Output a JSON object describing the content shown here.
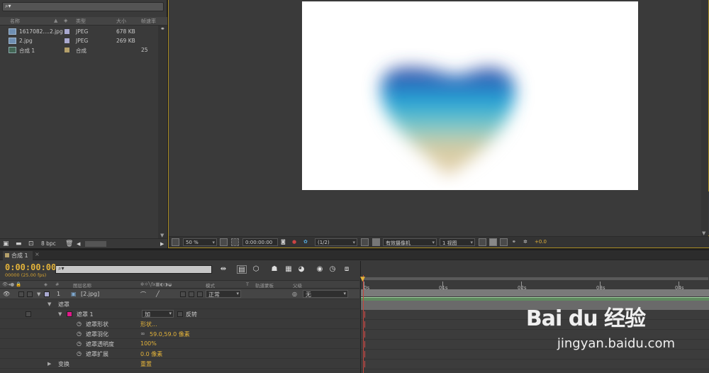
{
  "project": {
    "search_icon": "magnifier-icon",
    "headers": {
      "name": "名称",
      "type": "类型",
      "size": "大小",
      "fps": "帧速率"
    },
    "items": [
      {
        "name": "1617082....2.jpg",
        "type": "JPEG",
        "size": "678 KB",
        "fps": "",
        "label_color": "#a9a9d0",
        "icon": "image-file-icon"
      },
      {
        "name": "2.jpg",
        "type": "JPEG",
        "size": "269 KB",
        "fps": "",
        "label_color": "#a9a9d0",
        "icon": "image-file-icon"
      },
      {
        "name": "合成 1",
        "type": "合成",
        "size": "",
        "fps": "25",
        "label_color": "#b4a06a",
        "icon": "composition-icon"
      }
    ],
    "bpc": "8 bpc"
  },
  "viewer": {
    "zoom": "50 %",
    "timecode": "0:00:00:00",
    "resolution": "(1/2)",
    "camera": "有效摄像机",
    "views": "1 视图",
    "exposure": "+0.0"
  },
  "timeline": {
    "tab": "合成 1",
    "timecode": "0:00:00:00",
    "fps_line": "00000 (25.00 fps)",
    "time_labels": [
      "0s",
      "01s",
      "02s",
      "03s",
      "04s"
    ],
    "layer_headers": {
      "number": "#",
      "source_name": "图层名称",
      "mode": "模式",
      "t": "T",
      "trkmat": "轨道蒙板",
      "parent": "父级"
    },
    "layer": {
      "number": "1",
      "name": "[2.jpg]",
      "mode": "正常",
      "parent": "无"
    },
    "mask_group": "遮罩",
    "mask": {
      "name": "遮罩 1",
      "mode": "加",
      "invert": "反转",
      "color": "#e0198a"
    },
    "props": [
      {
        "name": "遮罩形状",
        "value": "形状..."
      },
      {
        "name": "遮罩羽化",
        "value": "59.0,59.0 像素"
      },
      {
        "name": "遮罩透明度",
        "value": "100%"
      },
      {
        "name": "遮罩扩展",
        "value": "0.0 像素"
      }
    ],
    "transform": {
      "name": "变换",
      "value": "重置"
    }
  },
  "watermark": {
    "logo": "Bai du 经验",
    "url": "jingyan.baidu.com"
  }
}
